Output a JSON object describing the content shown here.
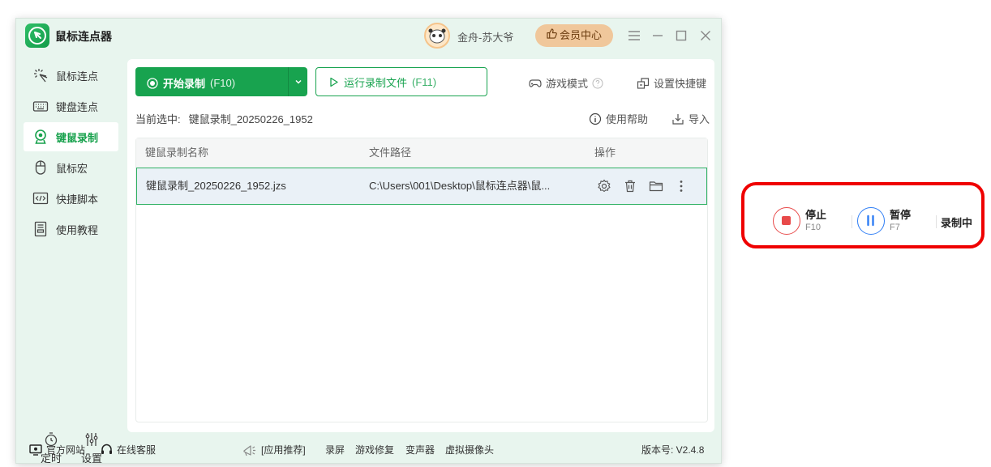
{
  "app": {
    "title": "鼠标连点器",
    "username": "金舟-苏大爷",
    "vip_label": "会员中心"
  },
  "sidebar": {
    "items": [
      {
        "label": "鼠标连点",
        "icon": "click-icon"
      },
      {
        "label": "键盘连点",
        "icon": "keyboard-icon"
      },
      {
        "label": "键鼠录制",
        "icon": "record-camera-icon",
        "active": true
      },
      {
        "label": "鼠标宏",
        "icon": "mouse-icon"
      },
      {
        "label": "快捷脚本",
        "icon": "script-icon"
      },
      {
        "label": "使用教程",
        "icon": "tutorial-icon"
      }
    ],
    "bottom": [
      {
        "label": "定时",
        "icon": "timer-icon"
      },
      {
        "label": "设置",
        "icon": "sliders-icon"
      }
    ]
  },
  "toolbar": {
    "start_record_label": "开始录制",
    "start_record_hotkey": "(F10)",
    "run_file_label": "运行录制文件",
    "run_file_hotkey": "(F11)",
    "game_mode_label": "游戏模式",
    "set_hotkey_label": "设置快捷键",
    "help_label": "使用帮助",
    "import_label": "导入"
  },
  "selection": {
    "prefix": "当前选中:",
    "value": "键鼠录制_20250226_1952"
  },
  "table": {
    "columns": [
      "键鼠录制名称",
      "文件路径",
      "操作"
    ],
    "rows": [
      {
        "name": "键鼠录制_20250226_1952.jzs",
        "path": "C:\\Users\\001\\Desktop\\鼠标连点器\\鼠...",
        "selected": true
      }
    ]
  },
  "footer": {
    "website_label": "官方网站",
    "service_label": "在线客服",
    "recommend_label": "[应用推荐]",
    "apps": [
      "录屏",
      "游戏修复",
      "变声器",
      "虚拟摄像头"
    ],
    "version_label": "版本号: V2.4.8"
  },
  "recorder": {
    "stop_label": "停止",
    "stop_hotkey": "F10",
    "pause_label": "暂停",
    "pause_hotkey": "F7",
    "status": "录制中"
  },
  "colors": {
    "primary_green": "#18a34f",
    "sidebar_bg": "#e8f5ee",
    "vip_gold": "#f0c79b",
    "stop_red": "#e84a4a",
    "pause_blue": "#2f7ef5",
    "highlight_border": "#ef0000"
  }
}
